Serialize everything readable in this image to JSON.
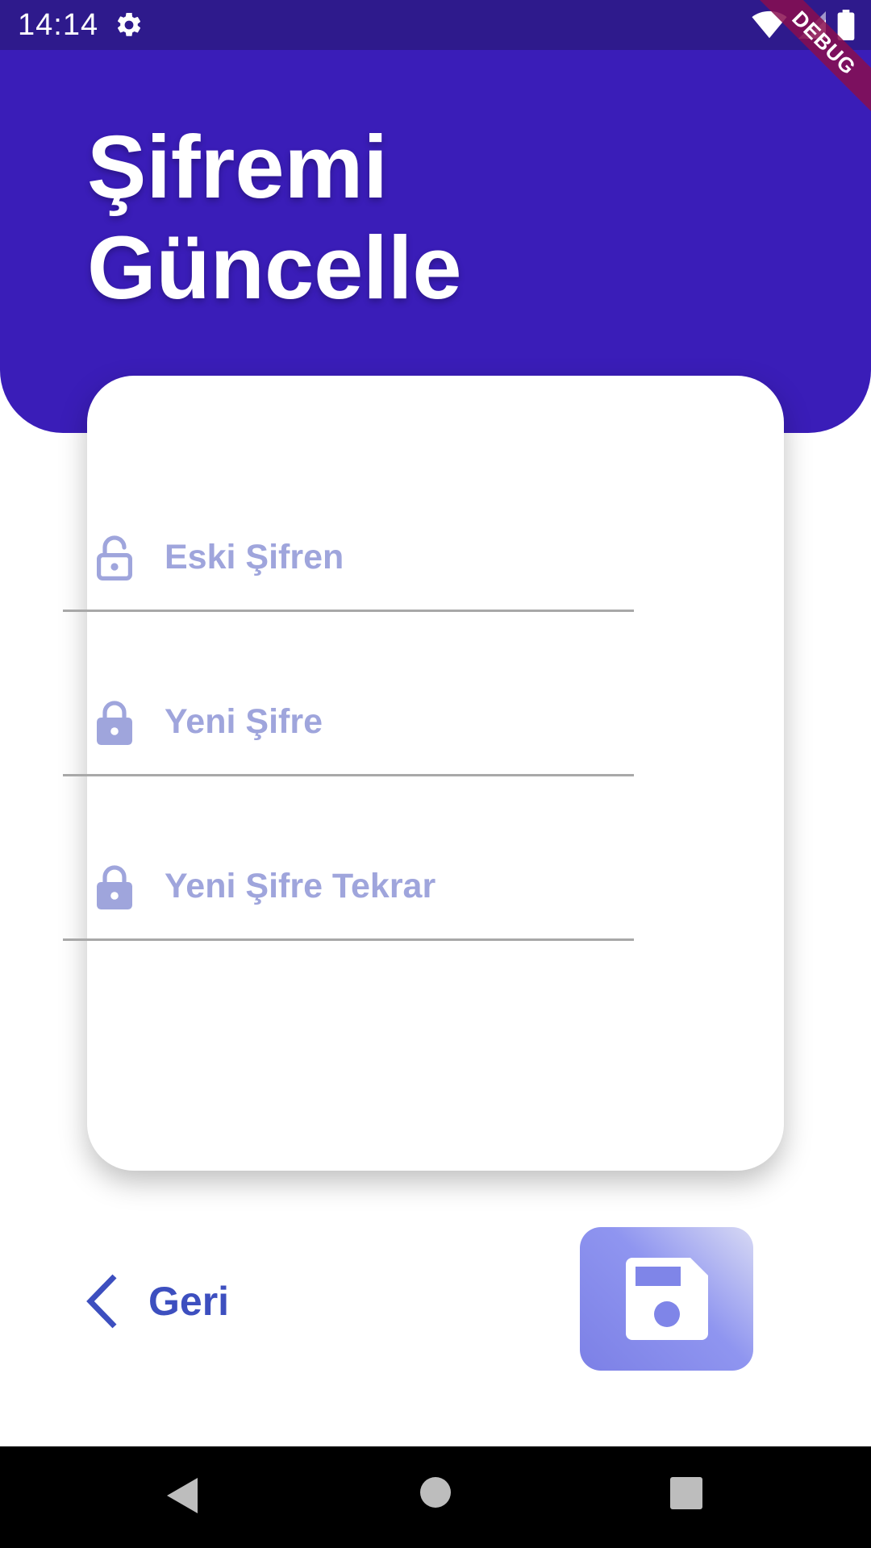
{
  "status_bar": {
    "time": "14:14",
    "left_icons": [
      "gear-icon"
    ],
    "right_icons": [
      "wifi-icon",
      "signal-icon",
      "battery-icon"
    ]
  },
  "debug_banner": "DEBUG",
  "header": {
    "title_line1": "Şifremi",
    "title_line2": "Güncelle"
  },
  "form": {
    "fields": [
      {
        "icon": "lock-open-icon",
        "placeholder": "Eski Şifren"
      },
      {
        "icon": "lock-icon",
        "placeholder": "Yeni Şifre"
      },
      {
        "icon": "lock-icon",
        "placeholder": "Yeni Şifre Tekrar"
      }
    ]
  },
  "actions": {
    "back_label": "Geri",
    "save_icon": "save-icon"
  },
  "colors": {
    "header_bg": "#3a1db8",
    "status_bar_bg": "#2e1a8c",
    "placeholder": "#9fa5dc",
    "back_text": "#3d4fbf",
    "save_gradient_start": "#7c80e6",
    "save_gradient_end": "#d7d9f4"
  },
  "nav_bar": {
    "buttons": [
      "nav-back-icon",
      "nav-home-icon",
      "nav-recents-icon"
    ]
  }
}
